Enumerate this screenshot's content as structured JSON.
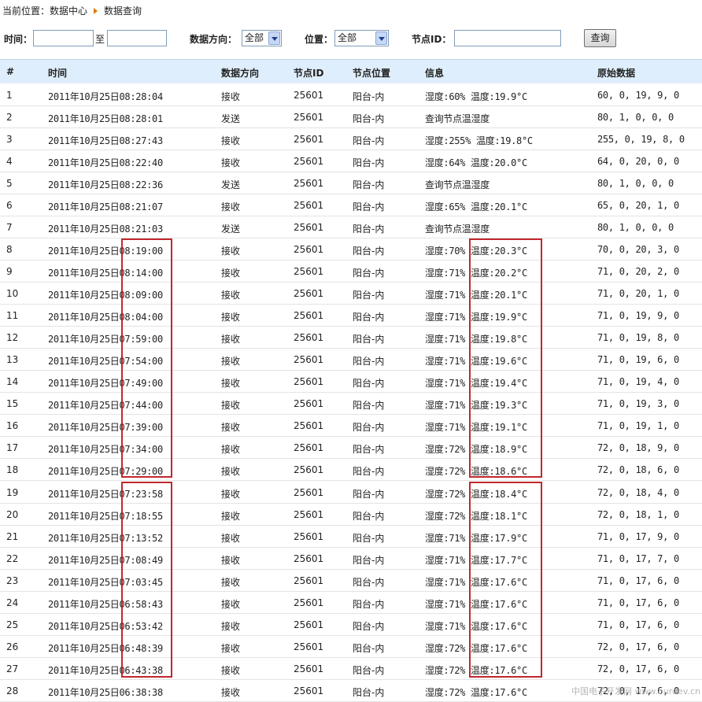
{
  "breadcrumb": {
    "prefix": "当前位置：",
    "section": "数据中心",
    "page": "数据查询"
  },
  "filters": {
    "time_label": "时间：",
    "time_to": "至",
    "time_from_value": "",
    "time_to_value": "",
    "direction_label": "数据方向：",
    "direction_selected": "全部",
    "location_label": "位置：",
    "location_selected": "全部",
    "node_label": "节点ID：",
    "node_value": "",
    "query_button": "查询"
  },
  "table": {
    "columns": [
      "#",
      "时间",
      "数据方向",
      "节点ID",
      "节点位置",
      "信息",
      "原始数据"
    ],
    "rows": [
      [
        "1",
        "2011年10月25日08:28:04",
        "接收",
        "25601",
        "阳台-内",
        "湿度:60% 温度:19.9°C",
        "60, 0, 19, 9, 0"
      ],
      [
        "2",
        "2011年10月25日08:28:01",
        "发送",
        "25601",
        "阳台-内",
        "查询节点温湿度",
        "80, 1, 0, 0, 0"
      ],
      [
        "3",
        "2011年10月25日08:27:43",
        "接收",
        "25601",
        "阳台-内",
        "湿度:255% 温度:19.8°C",
        "255, 0, 19, 8, 0"
      ],
      [
        "4",
        "2011年10月25日08:22:40",
        "接收",
        "25601",
        "阳台-内",
        "湿度:64% 温度:20.0°C",
        "64, 0, 20, 0, 0"
      ],
      [
        "5",
        "2011年10月25日08:22:36",
        "发送",
        "25601",
        "阳台-内",
        "查询节点温湿度",
        "80, 1, 0, 0, 0"
      ],
      [
        "6",
        "2011年10月25日08:21:07",
        "接收",
        "25601",
        "阳台-内",
        "湿度:65% 温度:20.1°C",
        "65, 0, 20, 1, 0"
      ],
      [
        "7",
        "2011年10月25日08:21:03",
        "发送",
        "25601",
        "阳台-内",
        "查询节点温湿度",
        "80, 1, 0, 0, 0"
      ],
      [
        "8",
        "2011年10月25日08:19:00",
        "接收",
        "25601",
        "阳台-内",
        "湿度:70% 温度:20.3°C",
        "70, 0, 20, 3, 0"
      ],
      [
        "9",
        "2011年10月25日08:14:00",
        "接收",
        "25601",
        "阳台-内",
        "湿度:71% 温度:20.2°C",
        "71, 0, 20, 2, 0"
      ],
      [
        "10",
        "2011年10月25日08:09:00",
        "接收",
        "25601",
        "阳台-内",
        "湿度:71% 温度:20.1°C",
        "71, 0, 20, 1, 0"
      ],
      [
        "11",
        "2011年10月25日08:04:00",
        "接收",
        "25601",
        "阳台-内",
        "湿度:71% 温度:19.9°C",
        "71, 0, 19, 9, 0"
      ],
      [
        "12",
        "2011年10月25日07:59:00",
        "接收",
        "25601",
        "阳台-内",
        "湿度:71% 温度:19.8°C",
        "71, 0, 19, 8, 0"
      ],
      [
        "13",
        "2011年10月25日07:54:00",
        "接收",
        "25601",
        "阳台-内",
        "湿度:71% 温度:19.6°C",
        "71, 0, 19, 6, 0"
      ],
      [
        "14",
        "2011年10月25日07:49:00",
        "接收",
        "25601",
        "阳台-内",
        "湿度:71% 温度:19.4°C",
        "71, 0, 19, 4, 0"
      ],
      [
        "15",
        "2011年10月25日07:44:00",
        "接收",
        "25601",
        "阳台-内",
        "湿度:71% 温度:19.3°C",
        "71, 0, 19, 3, 0"
      ],
      [
        "16",
        "2011年10月25日07:39:00",
        "接收",
        "25601",
        "阳台-内",
        "湿度:71% 温度:19.1°C",
        "71, 0, 19, 1, 0"
      ],
      [
        "17",
        "2011年10月25日07:34:00",
        "接收",
        "25601",
        "阳台-内",
        "湿度:72% 温度:18.9°C",
        "72, 0, 18, 9, 0"
      ],
      [
        "18",
        "2011年10月25日07:29:00",
        "接收",
        "25601",
        "阳台-内",
        "湿度:72% 温度:18.6°C",
        "72, 0, 18, 6, 0"
      ],
      [
        "19",
        "2011年10月25日07:23:58",
        "接收",
        "25601",
        "阳台-内",
        "湿度:72% 温度:18.4°C",
        "72, 0, 18, 4, 0"
      ],
      [
        "20",
        "2011年10月25日07:18:55",
        "接收",
        "25601",
        "阳台-内",
        "湿度:72% 温度:18.1°C",
        "72, 0, 18, 1, 0"
      ],
      [
        "21",
        "2011年10月25日07:13:52",
        "接收",
        "25601",
        "阳台-内",
        "湿度:71% 温度:17.9°C",
        "71, 0, 17, 9, 0"
      ],
      [
        "22",
        "2011年10月25日07:08:49",
        "接收",
        "25601",
        "阳台-内",
        "湿度:71% 温度:17.7°C",
        "71, 0, 17, 7, 0"
      ],
      [
        "23",
        "2011年10月25日07:03:45",
        "接收",
        "25601",
        "阳台-内",
        "湿度:71% 温度:17.6°C",
        "71, 0, 17, 6, 0"
      ],
      [
        "24",
        "2011年10月25日06:58:43",
        "接收",
        "25601",
        "阳台-内",
        "湿度:71% 温度:17.6°C",
        "71, 0, 17, 6, 0"
      ],
      [
        "25",
        "2011年10月25日06:53:42",
        "接收",
        "25601",
        "阳台-内",
        "湿度:71% 温度:17.6°C",
        "71, 0, 17, 6, 0"
      ],
      [
        "26",
        "2011年10月25日06:48:39",
        "接收",
        "25601",
        "阳台-内",
        "湿度:72% 温度:17.6°C",
        "72, 0, 17, 6, 0"
      ],
      [
        "27",
        "2011年10月25日06:43:38",
        "接收",
        "25601",
        "阳台-内",
        "湿度:72% 温度:17.6°C",
        "72, 0, 17, 6, 0"
      ],
      [
        "28",
        "2011年10月25日06:38:38",
        "接收",
        "25601",
        "阳台-内",
        "湿度:72% 温度:17.6°C",
        "72, 0, 17, 6, 0"
      ]
    ]
  },
  "colors": {
    "header_bg": "#dfeefc",
    "highlight_box": "#c0282d",
    "breadcrumb_arrow": "#e07a00"
  },
  "watermark": "中国电子开发网 www.ourdev.cn"
}
